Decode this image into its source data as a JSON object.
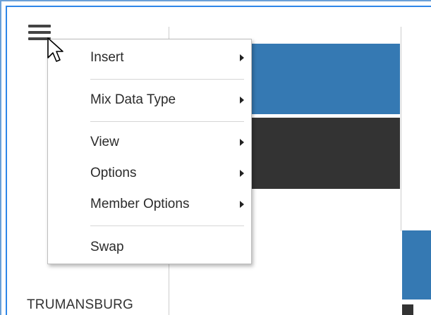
{
  "menu_button": {
    "icon": "hamburger-icon"
  },
  "context_menu": {
    "items": [
      {
        "label": "Insert",
        "has_submenu": true
      },
      {
        "label": "Mix Data Type",
        "has_submenu": true
      },
      {
        "label": "View",
        "has_submenu": true
      },
      {
        "label": "Options",
        "has_submenu": true
      },
      {
        "label": "Member Options",
        "has_submenu": true
      },
      {
        "label": "Swap",
        "has_submenu": false
      }
    ]
  },
  "row_header": {
    "label": "TRUMANSBURG"
  },
  "colors": {
    "bar_blue": "#3579b3",
    "bar_dark": "#333333",
    "frame_blue": "#2e86e8"
  }
}
